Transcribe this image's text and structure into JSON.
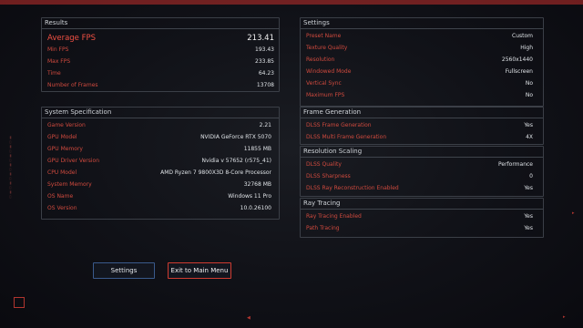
{
  "results": {
    "title": "Results",
    "average_fps_label": "Average FPS",
    "average_fps_value": "213.41",
    "rows": [
      {
        "label": "Min FPS",
        "value": "193.43"
      },
      {
        "label": "Max FPS",
        "value": "233.85"
      },
      {
        "label": "Time",
        "value": "64.23"
      },
      {
        "label": "Number of Frames",
        "value": "13708"
      }
    ]
  },
  "system": {
    "title": "System Specification",
    "rows": [
      {
        "label": "Game Version",
        "value": "2.21"
      },
      {
        "label": "GPU Model",
        "value": "NVIDIA GeForce RTX 5070"
      },
      {
        "label": "GPU Memory",
        "value": "11855 MB"
      },
      {
        "label": "GPU Driver Version",
        "value": "Nvidia v 57652 (r575_41)"
      },
      {
        "label": "CPU Model",
        "value": "AMD Ryzen 7 9800X3D 8-Core Processor"
      },
      {
        "label": "System Memory",
        "value": "32768 MB"
      },
      {
        "label": "OS Name",
        "value": "Windows 11 Pro"
      },
      {
        "label": "OS Version",
        "value": "10.0.26100"
      }
    ]
  },
  "settings": {
    "title": "Settings",
    "rows": [
      {
        "label": "Preset Name",
        "value": "Custom"
      },
      {
        "label": "Texture Quality",
        "value": "High"
      },
      {
        "label": "Resolution",
        "value": "2560x1440"
      },
      {
        "label": "Windowed Mode",
        "value": "Fullscreen"
      },
      {
        "label": "Vertical Sync",
        "value": "No"
      },
      {
        "label": "Maximum FPS",
        "value": "No"
      }
    ]
  },
  "frame_generation": {
    "title": "Frame Generation",
    "rows": [
      {
        "label": "DLSS Frame Generation",
        "value": "Yes"
      },
      {
        "label": "DLSS Multi Frame Generation",
        "value": "4X"
      }
    ]
  },
  "resolution_scaling": {
    "title": "Resolution Scaling",
    "rows": [
      {
        "label": "DLSS Quality",
        "value": "Performance"
      },
      {
        "label": "DLSS Sharpness",
        "value": "0"
      },
      {
        "label": "DLSS Ray Reconstruction Enabled",
        "value": "Yes"
      }
    ]
  },
  "ray_tracing": {
    "title": "Ray Tracing",
    "rows": [
      {
        "label": "Ray Tracing Enabled",
        "value": "Yes"
      },
      {
        "label": "Path Tracing",
        "value": "Yes"
      }
    ]
  },
  "buttons": {
    "settings_label": "Settings",
    "exit_label": "Exit to Main Menu"
  },
  "colors": {
    "accent_red": "#d04a3e",
    "value_white": "#dfe3e7",
    "button_blue": "#3a5a8c"
  }
}
